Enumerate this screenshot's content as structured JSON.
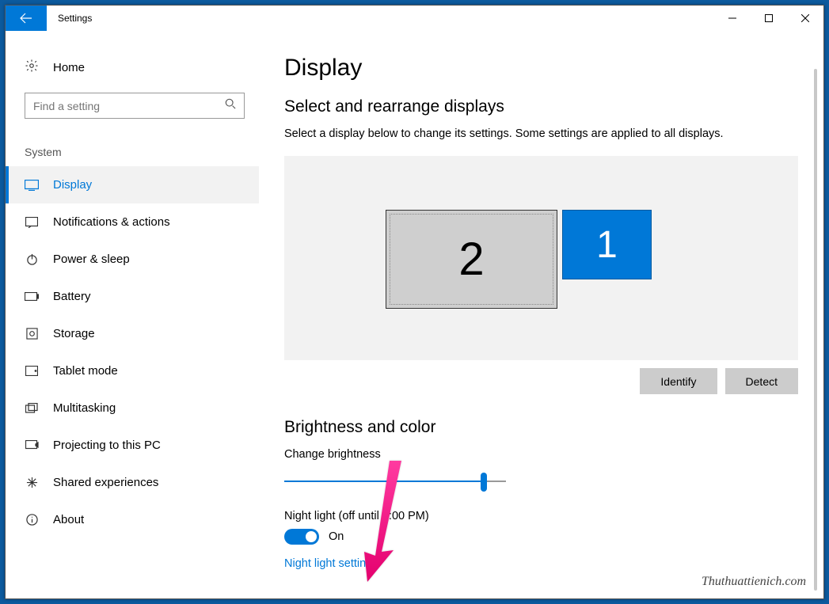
{
  "titlebar": {
    "title": "Settings"
  },
  "sidebar": {
    "home_label": "Home",
    "search_placeholder": "Find a setting",
    "section_label": "System",
    "items": [
      {
        "label": "Display"
      },
      {
        "label": "Notifications & actions"
      },
      {
        "label": "Power & sleep"
      },
      {
        "label": "Battery"
      },
      {
        "label": "Storage"
      },
      {
        "label": "Tablet mode"
      },
      {
        "label": "Multitasking"
      },
      {
        "label": "Projecting to this PC"
      },
      {
        "label": "Shared experiences"
      },
      {
        "label": "About"
      }
    ]
  },
  "main": {
    "page_title": "Display",
    "arrange_heading": "Select and rearrange displays",
    "arrange_desc": "Select a display below to change its settings. Some settings are applied to all displays.",
    "monitor1": "1",
    "monitor2": "2",
    "identify_btn": "Identify",
    "detect_btn": "Detect",
    "brightness_heading": "Brightness and color",
    "brightness_label": "Change brightness",
    "night_label": "Night light (off until 9:00 PM)",
    "toggle_state": "On",
    "night_link": "Night light settings"
  },
  "watermark": "Thuthuattienich.com"
}
